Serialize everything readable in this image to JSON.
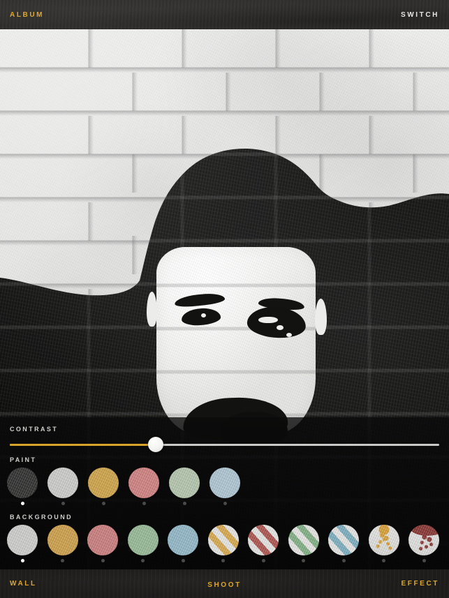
{
  "topbar": {
    "album_label": "ALBUM",
    "switch_label": "SWITCH"
  },
  "panel": {
    "contrast": {
      "label": "CONTRAST",
      "value_percent": 34,
      "fill_color": "#d9a32a",
      "track_color": "#c9c9c7",
      "knob_color": "#ffffff"
    },
    "paint": {
      "label": "PAINT",
      "selected_index": 0,
      "swatches": [
        {
          "name": "paint-swatch-charcoal",
          "color": "#3a3a39",
          "style": "solid",
          "selected": true
        },
        {
          "name": "paint-swatch-white",
          "color": "#e3e3e1",
          "style": "solid",
          "selected": false
        },
        {
          "name": "paint-swatch-gold",
          "color": "#e5b755",
          "style": "solid",
          "selected": false
        },
        {
          "name": "paint-swatch-salmon",
          "color": "#e79191",
          "style": "solid",
          "selected": false
        },
        {
          "name": "paint-swatch-sage",
          "color": "#c8dcc2",
          "style": "solid",
          "selected": false
        },
        {
          "name": "paint-swatch-skyblue",
          "color": "#c2dcea",
          "style": "solid",
          "selected": false
        }
      ]
    },
    "background": {
      "label": "BACKGROUND",
      "selected_index": 0,
      "swatches": [
        {
          "name": "background-swatch-white",
          "color": "#e5e5e3",
          "style": "solid",
          "selected": true
        },
        {
          "name": "background-swatch-gold",
          "color": "#e4b357",
          "style": "solid",
          "selected": false
        },
        {
          "name": "background-swatch-salmon",
          "color": "#e18d8d",
          "style": "solid",
          "selected": false
        },
        {
          "name": "background-swatch-sage",
          "color": "#a9cfa9",
          "style": "solid",
          "selected": false
        },
        {
          "name": "background-swatch-skyblue",
          "color": "#a4cddd",
          "style": "solid",
          "selected": false
        },
        {
          "name": "background-swatch-gold-stripes",
          "color": "#e0b155",
          "style": "stripes",
          "selected": false
        },
        {
          "name": "background-swatch-red-stripes",
          "color": "#b45b55",
          "style": "stripes",
          "selected": false
        },
        {
          "name": "background-swatch-green-stripes",
          "color": "#88b78c",
          "style": "stripes",
          "selected": false
        },
        {
          "name": "background-swatch-blue-stripes",
          "color": "#83b6c6",
          "style": "stripes",
          "selected": false
        },
        {
          "name": "background-swatch-gold-splatter",
          "color": "#dfa83e",
          "style": "splatter",
          "selected": false
        },
        {
          "name": "background-swatch-red-splatter",
          "color": "#8f3c38",
          "style": "drip",
          "selected": false
        }
      ]
    }
  },
  "bottombar": {
    "wall_label": "WALL",
    "shoot_label": "SHOOT",
    "effect_label": "EFFECT"
  },
  "photo": {
    "subject": "stencil-street-art-portrait-on-white-brick-wall"
  }
}
